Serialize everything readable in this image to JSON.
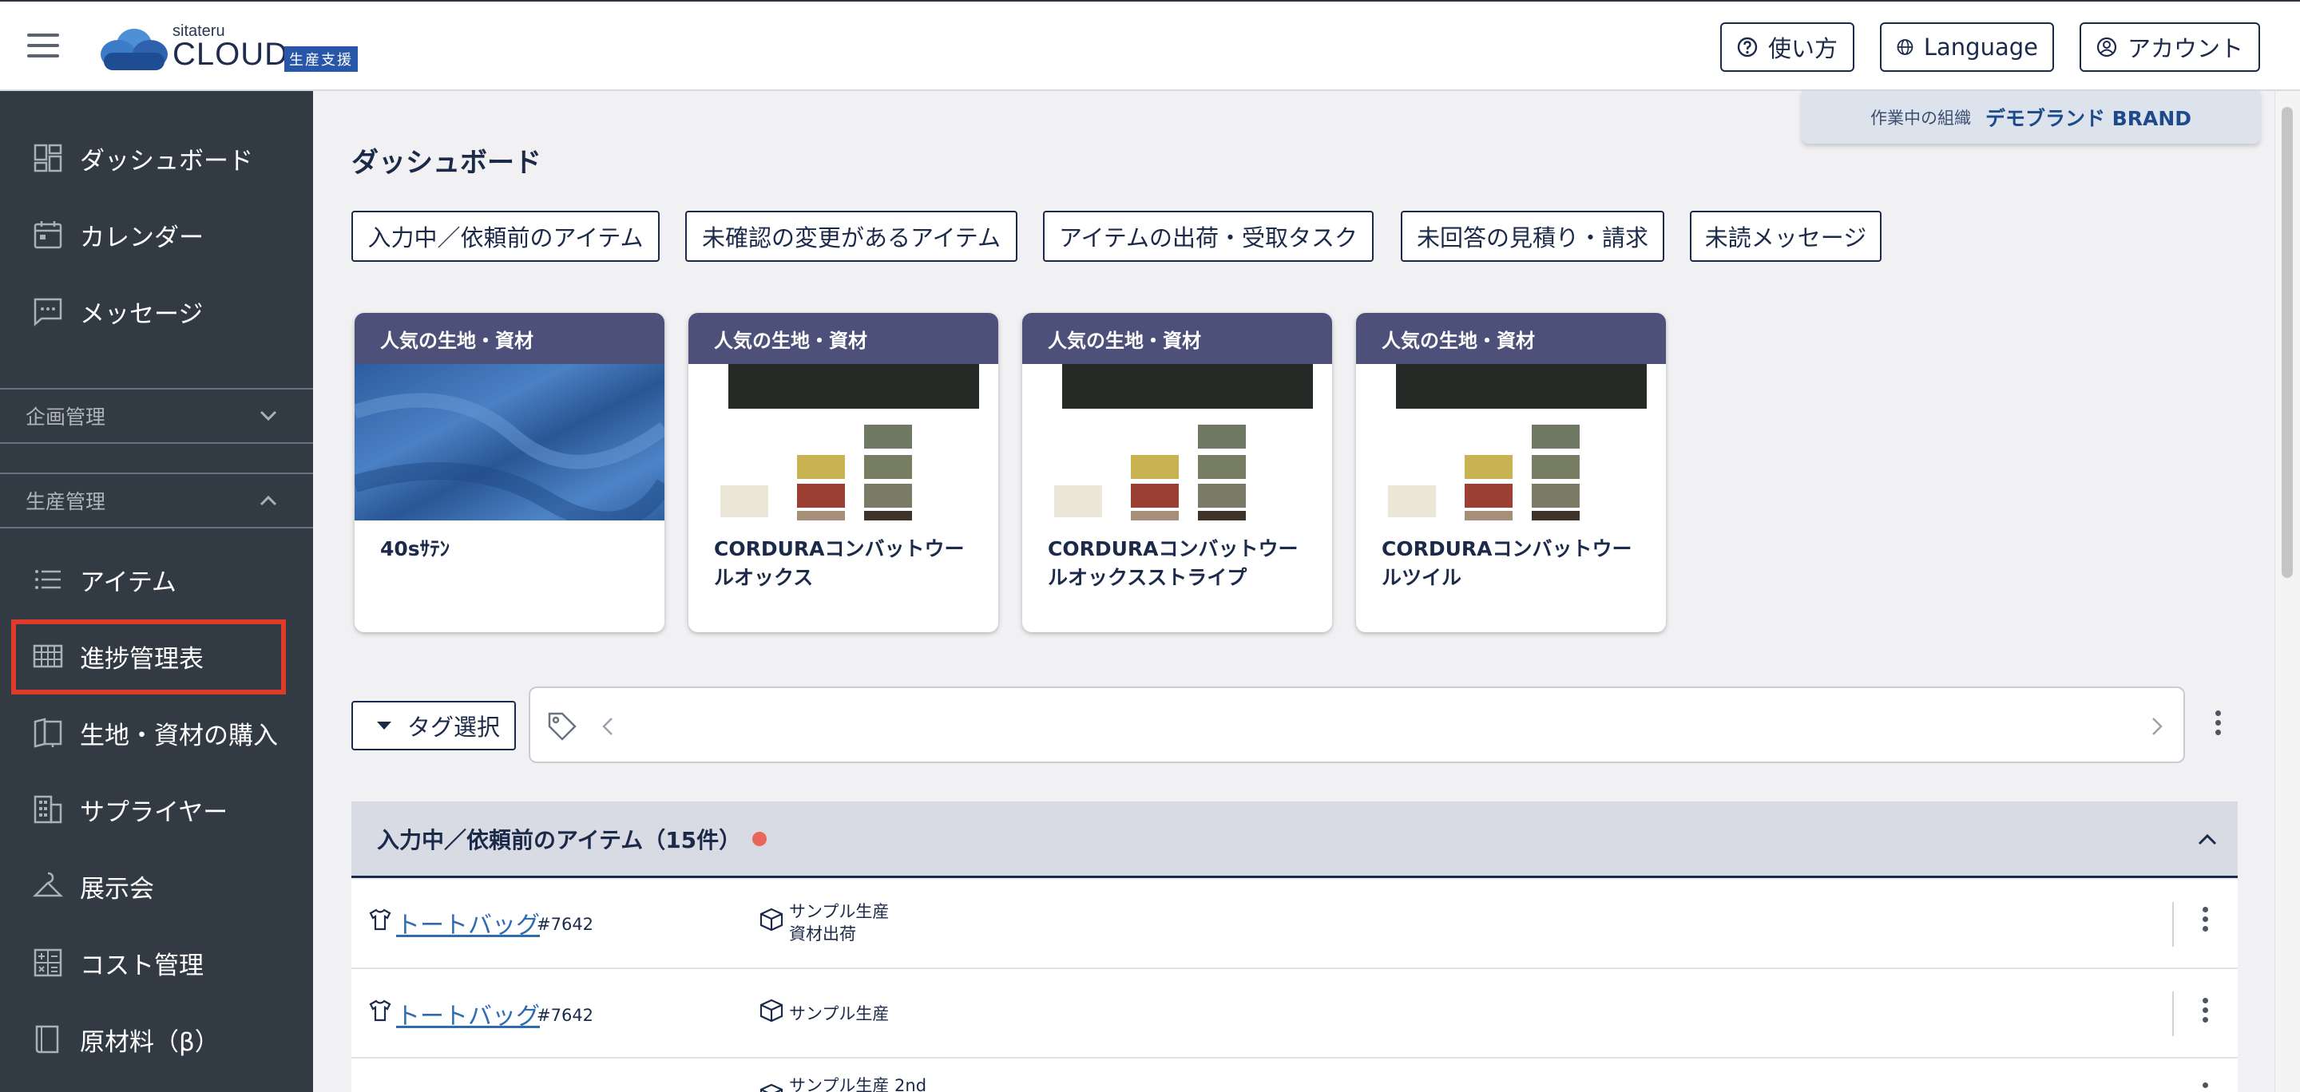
{
  "header": {
    "logo_small": "sitateru",
    "logo_main": "CLOUD",
    "logo_badge": "生産支援",
    "help_label": "使い方",
    "language_label": "Language",
    "account_label": "アカウント",
    "org_label": "作業中の組織",
    "org_name": "デモブランド BRAND"
  },
  "sidebar": {
    "top_items": [
      {
        "label": "ダッシュボード",
        "icon": "dashboard-icon"
      },
      {
        "label": "カレンダー",
        "icon": "calendar-icon"
      },
      {
        "label": "メッセージ",
        "icon": "message-icon"
      }
    ],
    "section_planning": "企画管理",
    "section_production": "生産管理",
    "production_items": [
      {
        "label": "アイテム",
        "icon": "list-icon"
      },
      {
        "label": "進捗管理表",
        "icon": "grid-table-icon"
      },
      {
        "label": "生地・資材の購入",
        "icon": "fabric-book-icon"
      },
      {
        "label": "サプライヤー",
        "icon": "building-icon"
      },
      {
        "label": "展示会",
        "icon": "hanger-icon"
      },
      {
        "label": "コスト管理",
        "icon": "calculator-icon"
      },
      {
        "label": "原材料（β）",
        "icon": "book-icon"
      }
    ]
  },
  "main": {
    "title": "ダッシュボード",
    "quick_filters": [
      "入力中／依頼前のアイテム",
      "未確認の変更があるアイテム",
      "アイテムの出荷・受取タスク",
      "未回答の見積り・請求",
      "未読メッセージ"
    ],
    "cards": [
      {
        "header": "人気の生地・資材",
        "name": "40sｻﾃﾝ"
      },
      {
        "header": "人気の生地・資材",
        "name": "CORDURAコンバットウールオックス"
      },
      {
        "header": "人気の生地・資材",
        "name": "CORDURAコンバットウールオックスストライプ"
      },
      {
        "header": "人気の生地・資材",
        "name": "CORDURAコンバットウールツイル"
      }
    ],
    "tag_select_label": "タグ選択",
    "section_title": "入力中／依頼前のアイテム（15件）",
    "rows": [
      {
        "name": "トートバッグ",
        "id": "#7642",
        "status_line1": "サンプル生産",
        "status_line2": "資材出荷"
      },
      {
        "name": "トートバッグ",
        "id": "#7642",
        "status_line1": "サンプル生産",
        "status_line2": ""
      },
      {
        "name": "",
        "id": "",
        "status_line1": "サンプル生産 2nd",
        "status_line2": ""
      }
    ]
  },
  "colors": {
    "sidebar_bg": "#323a44",
    "card_header": "#4d5179",
    "accent_link": "#2e6bb0",
    "highlight": "#e03a2a",
    "badge": "#2856a8"
  }
}
